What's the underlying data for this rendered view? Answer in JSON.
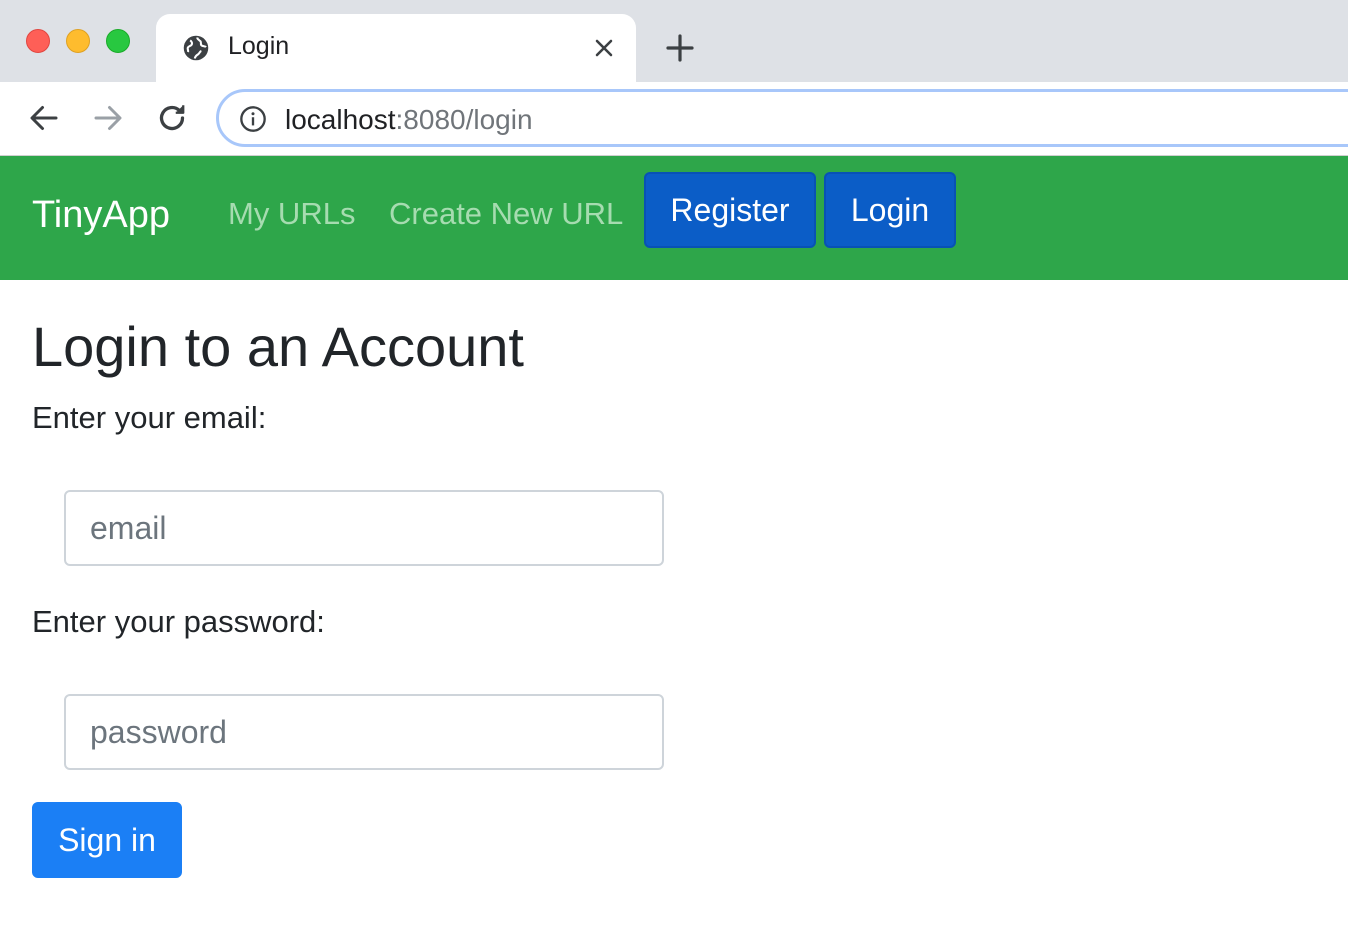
{
  "browser": {
    "tab": {
      "title": "Login"
    },
    "address_bar": {
      "host": "localhost",
      "path": ":8080/login"
    }
  },
  "navbar": {
    "brand": "TinyApp",
    "links": [
      "My URLs",
      "Create New URL"
    ],
    "register_label": "Register",
    "login_label": "Login",
    "background_color": "#2ea64a",
    "button_color": "#0b5dc7"
  },
  "main": {
    "title": "Login to an Account",
    "email_label": "Enter your email:",
    "email_placeholder": "email",
    "password_label": "Enter your password:",
    "password_placeholder": "password",
    "submit_label": "Sign in",
    "submit_color": "#1b7ff5"
  },
  "icons": {
    "tab_icon": "globe-icon",
    "tab_close": "close-icon",
    "new_tab": "plus-icon",
    "back": "arrow-left-icon",
    "forward": "arrow-right-icon",
    "reload": "reload-icon",
    "site_info": "info-icon"
  }
}
